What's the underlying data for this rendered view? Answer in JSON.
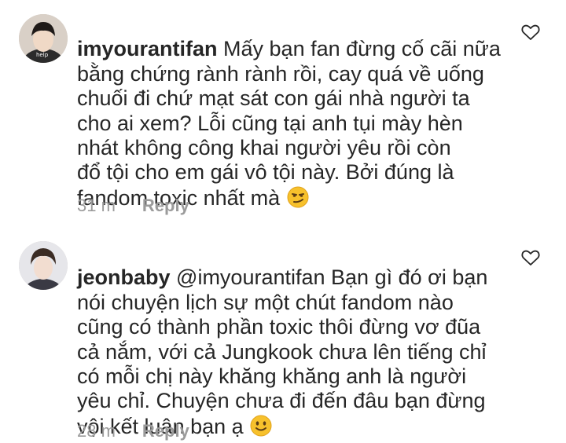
{
  "comments": [
    {
      "username": "imyourantifan",
      "avatar_caption": "help",
      "body": " Mấy bạn fan đừng cố cãi nữa\nbằng chứng rành rành rồi, cay quá về uống\nchuối đi chứ mạt sát con gái nhà người ta\ncho ai xem? Lỗi cũng tại anh tụi mày hèn\nnhát không công khai người yêu rồi còn\nđổ tội cho em gái vô tội này. Bởi đúng là\nfandom toxic nhất mà ",
      "emoji": "smirking-face",
      "time": "31 m",
      "reply_label": "Reply"
    },
    {
      "username": "jeonbaby",
      "body": " @imyourantifan Bạn gì đó ơi bạn\nnói chuyện lịch sự một chút fandom nào\ncũng có thành phần toxic thôi đừng vơ đũa\ncả nắm, với cả Jungkook chưa lên tiếng chỉ\ncó mỗi chị này khăng khăng anh là người\nyêu chỉ. Chuyện chưa đi đến đâu bạn đừng\nvội kết luận bạn ạ ",
      "emoji": "slightly-smiling-face",
      "time": "28 m",
      "reply_label": "Reply"
    }
  ],
  "colors": {
    "text": "#262626",
    "meta": "#9b9b9b",
    "emoji_fill": "#f7c12c"
  }
}
